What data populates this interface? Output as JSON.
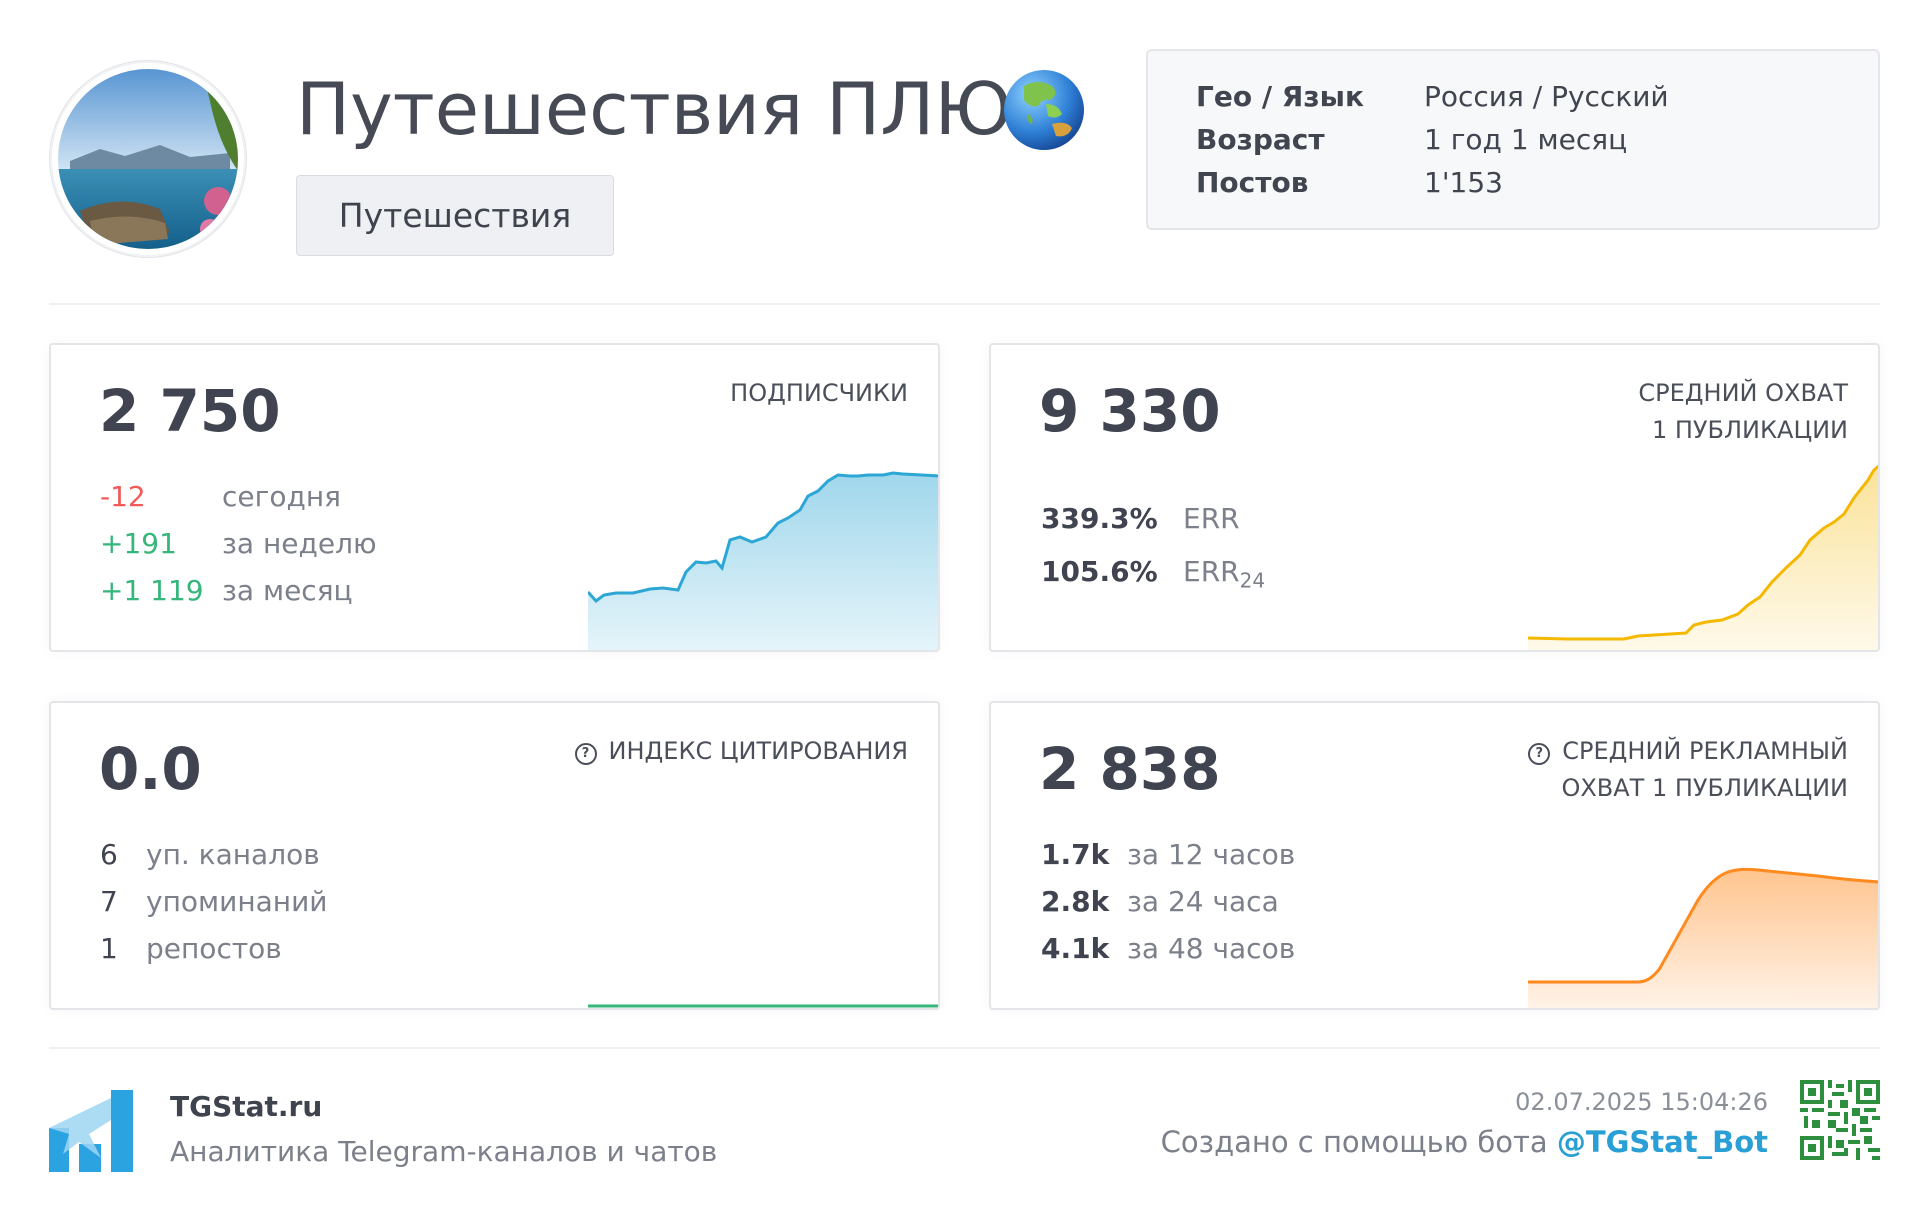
{
  "header": {
    "title": "Путешествия ПЛЮС",
    "category": "Путешествия",
    "info": [
      {
        "key": "Гео / Язык",
        "value": "Россия / Русский"
      },
      {
        "key": "Возраст",
        "value": "1 год 1 месяц"
      },
      {
        "key": "Постов",
        "value": "1'153"
      }
    ]
  },
  "icons": {
    "avatar": "channel-avatar-sea-landscape",
    "title_emoji": "globe-asia-australia-icon",
    "help": "question-circle-icon",
    "logo": "tgstat-logo-icon",
    "qr": "qr-code-icon"
  },
  "colors": {
    "blue": "#2ca6d4",
    "yellow": "#f5b800",
    "green": "#35b67a",
    "orange": "#ff8a1e",
    "red": "#ef5a5a",
    "link": "#2a9fd6"
  },
  "subscribers": {
    "value": "2 750",
    "label": "ПОДПИСЧИКИ",
    "changes": [
      {
        "num": "-12",
        "text": "сегодня"
      },
      {
        "num": "+191",
        "text": "за неделю"
      },
      {
        "num": "+1 119",
        "text": "за месяц"
      }
    ]
  },
  "reach": {
    "value": "9 330",
    "label_line1": "СРЕДНИЙ ОХВАТ",
    "label_line2": "1 ПУБЛИКАЦИИ",
    "err_value": "339.3%",
    "err_label": "ERR",
    "err24_value": "105.6%",
    "err24_label": "ERR",
    "err24_sub": "24"
  },
  "citation": {
    "value": "0.0",
    "label": "ИНДЕКС ЦИТИРОВАНИЯ",
    "stats": [
      {
        "num": "6",
        "text": "уп. каналов"
      },
      {
        "num": "7",
        "text": "упоминаний"
      },
      {
        "num": "1",
        "text": "репостов"
      }
    ]
  },
  "ad_reach": {
    "value": "2 838",
    "label_line1": "СРЕДНИЙ РЕКЛАМНЫЙ",
    "label_line2": "ОХВАТ 1 ПУБЛИКАЦИИ",
    "stats": [
      {
        "num": "1.7k",
        "text": "за 12 часов"
      },
      {
        "num": "2.8k",
        "text": "за 24 часа"
      },
      {
        "num": "4.1k",
        "text": "за 48 часов"
      }
    ]
  },
  "footer": {
    "site": "TGStat.ru",
    "tagline": "Аналитика Telegram-каналов и чатов",
    "date": "02.07.2025 15:04:26",
    "created_prefix": "Создано с помощью бота",
    "bot_link": "@TGStat_Bot"
  }
}
